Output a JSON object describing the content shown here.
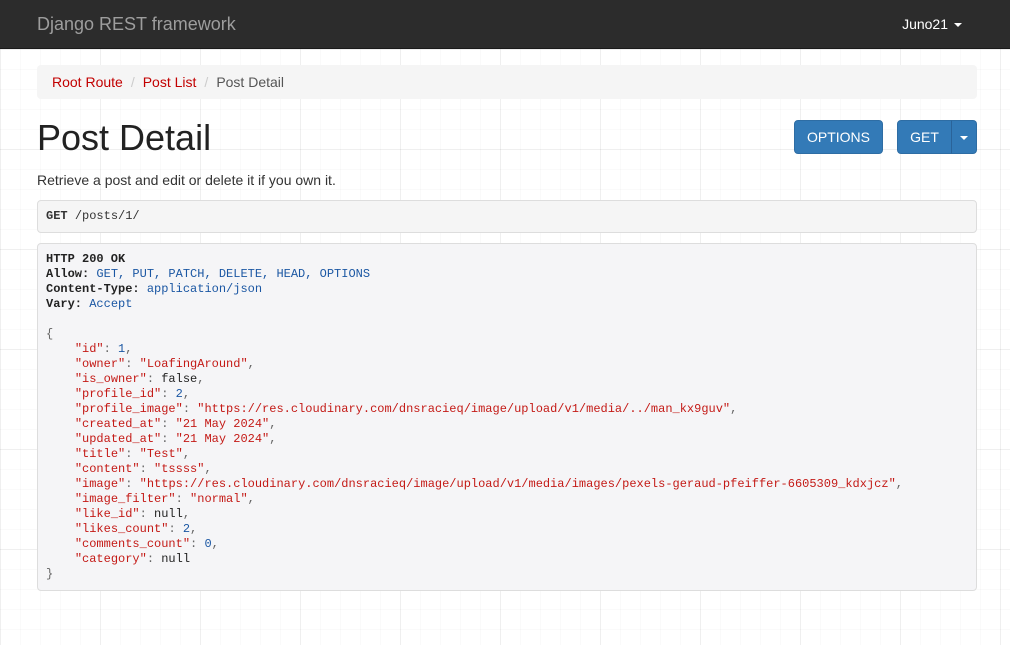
{
  "navbar": {
    "brand": "Django REST framework",
    "user": "Juno21"
  },
  "breadcrumb": [
    {
      "label": "Root Route",
      "active": false
    },
    {
      "label": "Post List",
      "active": false
    },
    {
      "label": "Post Detail",
      "active": true
    }
  ],
  "page": {
    "title": "Post Detail",
    "description": "Retrieve a post and edit or delete it if you own it."
  },
  "buttons": {
    "options": "OPTIONS",
    "get": "GET"
  },
  "request": {
    "method": "GET",
    "path": "/posts/1/"
  },
  "response": {
    "status": "HTTP 200 OK",
    "headers": [
      {
        "name": "Allow:",
        "value": "GET, PUT, PATCH, DELETE, HEAD, OPTIONS"
      },
      {
        "name": "Content-Type:",
        "value": "application/json"
      },
      {
        "name": "Vary:",
        "value": "Accept"
      }
    ],
    "body": [
      {
        "key": "\"id\"",
        "value": "1",
        "type": "number"
      },
      {
        "key": "\"owner\"",
        "value": "\"LoafingAround\"",
        "type": "string"
      },
      {
        "key": "\"is_owner\"",
        "value": "false",
        "type": "keyword"
      },
      {
        "key": "\"profile_id\"",
        "value": "2",
        "type": "number"
      },
      {
        "key": "\"profile_image\"",
        "value": "\"https://res.cloudinary.com/dnsracieq/image/upload/v1/media/../man_kx9guv\"",
        "type": "string"
      },
      {
        "key": "\"created_at\"",
        "value": "\"21 May 2024\"",
        "type": "string"
      },
      {
        "key": "\"updated_at\"",
        "value": "\"21 May 2024\"",
        "type": "string"
      },
      {
        "key": "\"title\"",
        "value": "\"Test\"",
        "type": "string"
      },
      {
        "key": "\"content\"",
        "value": "\"tssss\"",
        "type": "string"
      },
      {
        "key": "\"image\"",
        "value": "\"https://res.cloudinary.com/dnsracieq/image/upload/v1/media/images/pexels-geraud-pfeiffer-6605309_kdxjcz\"",
        "type": "string"
      },
      {
        "key": "\"image_filter\"",
        "value": "\"normal\"",
        "type": "string"
      },
      {
        "key": "\"like_id\"",
        "value": "null",
        "type": "keyword"
      },
      {
        "key": "\"likes_count\"",
        "value": "2",
        "type": "number"
      },
      {
        "key": "\"comments_count\"",
        "value": "0",
        "type": "number"
      },
      {
        "key": "\"category\"",
        "value": "null",
        "type": "keyword"
      }
    ]
  }
}
